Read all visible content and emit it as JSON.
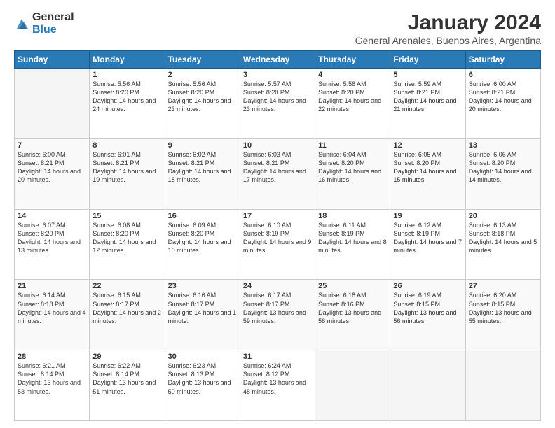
{
  "logo": {
    "general": "General",
    "blue": "Blue"
  },
  "title": "January 2024",
  "subtitle": "General Arenales, Buenos Aires, Argentina",
  "weekdays": [
    "Sunday",
    "Monday",
    "Tuesday",
    "Wednesday",
    "Thursday",
    "Friday",
    "Saturday"
  ],
  "weeks": [
    [
      {
        "day": "",
        "sunrise": "",
        "sunset": "",
        "daylight": ""
      },
      {
        "day": "1",
        "sunrise": "Sunrise: 5:56 AM",
        "sunset": "Sunset: 8:20 PM",
        "daylight": "Daylight: 14 hours and 24 minutes."
      },
      {
        "day": "2",
        "sunrise": "Sunrise: 5:56 AM",
        "sunset": "Sunset: 8:20 PM",
        "daylight": "Daylight: 14 hours and 23 minutes."
      },
      {
        "day": "3",
        "sunrise": "Sunrise: 5:57 AM",
        "sunset": "Sunset: 8:20 PM",
        "daylight": "Daylight: 14 hours and 23 minutes."
      },
      {
        "day": "4",
        "sunrise": "Sunrise: 5:58 AM",
        "sunset": "Sunset: 8:20 PM",
        "daylight": "Daylight: 14 hours and 22 minutes."
      },
      {
        "day": "5",
        "sunrise": "Sunrise: 5:59 AM",
        "sunset": "Sunset: 8:21 PM",
        "daylight": "Daylight: 14 hours and 21 minutes."
      },
      {
        "day": "6",
        "sunrise": "Sunrise: 6:00 AM",
        "sunset": "Sunset: 8:21 PM",
        "daylight": "Daylight: 14 hours and 20 minutes."
      }
    ],
    [
      {
        "day": "7",
        "sunrise": "Sunrise: 6:00 AM",
        "sunset": "Sunset: 8:21 PM",
        "daylight": "Daylight: 14 hours and 20 minutes."
      },
      {
        "day": "8",
        "sunrise": "Sunrise: 6:01 AM",
        "sunset": "Sunset: 8:21 PM",
        "daylight": "Daylight: 14 hours and 19 minutes."
      },
      {
        "day": "9",
        "sunrise": "Sunrise: 6:02 AM",
        "sunset": "Sunset: 8:21 PM",
        "daylight": "Daylight: 14 hours and 18 minutes."
      },
      {
        "day": "10",
        "sunrise": "Sunrise: 6:03 AM",
        "sunset": "Sunset: 8:21 PM",
        "daylight": "Daylight: 14 hours and 17 minutes."
      },
      {
        "day": "11",
        "sunrise": "Sunrise: 6:04 AM",
        "sunset": "Sunset: 8:20 PM",
        "daylight": "Daylight: 14 hours and 16 minutes."
      },
      {
        "day": "12",
        "sunrise": "Sunrise: 6:05 AM",
        "sunset": "Sunset: 8:20 PM",
        "daylight": "Daylight: 14 hours and 15 minutes."
      },
      {
        "day": "13",
        "sunrise": "Sunrise: 6:06 AM",
        "sunset": "Sunset: 8:20 PM",
        "daylight": "Daylight: 14 hours and 14 minutes."
      }
    ],
    [
      {
        "day": "14",
        "sunrise": "Sunrise: 6:07 AM",
        "sunset": "Sunset: 8:20 PM",
        "daylight": "Daylight: 14 hours and 13 minutes."
      },
      {
        "day": "15",
        "sunrise": "Sunrise: 6:08 AM",
        "sunset": "Sunset: 8:20 PM",
        "daylight": "Daylight: 14 hours and 12 minutes."
      },
      {
        "day": "16",
        "sunrise": "Sunrise: 6:09 AM",
        "sunset": "Sunset: 8:20 PM",
        "daylight": "Daylight: 14 hours and 10 minutes."
      },
      {
        "day": "17",
        "sunrise": "Sunrise: 6:10 AM",
        "sunset": "Sunset: 8:19 PM",
        "daylight": "Daylight: 14 hours and 9 minutes."
      },
      {
        "day": "18",
        "sunrise": "Sunrise: 6:11 AM",
        "sunset": "Sunset: 8:19 PM",
        "daylight": "Daylight: 14 hours and 8 minutes."
      },
      {
        "day": "19",
        "sunrise": "Sunrise: 6:12 AM",
        "sunset": "Sunset: 8:19 PM",
        "daylight": "Daylight: 14 hours and 7 minutes."
      },
      {
        "day": "20",
        "sunrise": "Sunrise: 6:13 AM",
        "sunset": "Sunset: 8:18 PM",
        "daylight": "Daylight: 14 hours and 5 minutes."
      }
    ],
    [
      {
        "day": "21",
        "sunrise": "Sunrise: 6:14 AM",
        "sunset": "Sunset: 8:18 PM",
        "daylight": "Daylight: 14 hours and 4 minutes."
      },
      {
        "day": "22",
        "sunrise": "Sunrise: 6:15 AM",
        "sunset": "Sunset: 8:17 PM",
        "daylight": "Daylight: 14 hours and 2 minutes."
      },
      {
        "day": "23",
        "sunrise": "Sunrise: 6:16 AM",
        "sunset": "Sunset: 8:17 PM",
        "daylight": "Daylight: 14 hours and 1 minute."
      },
      {
        "day": "24",
        "sunrise": "Sunrise: 6:17 AM",
        "sunset": "Sunset: 8:17 PM",
        "daylight": "Daylight: 13 hours and 59 minutes."
      },
      {
        "day": "25",
        "sunrise": "Sunrise: 6:18 AM",
        "sunset": "Sunset: 8:16 PM",
        "daylight": "Daylight: 13 hours and 58 minutes."
      },
      {
        "day": "26",
        "sunrise": "Sunrise: 6:19 AM",
        "sunset": "Sunset: 8:15 PM",
        "daylight": "Daylight: 13 hours and 56 minutes."
      },
      {
        "day": "27",
        "sunrise": "Sunrise: 6:20 AM",
        "sunset": "Sunset: 8:15 PM",
        "daylight": "Daylight: 13 hours and 55 minutes."
      }
    ],
    [
      {
        "day": "28",
        "sunrise": "Sunrise: 6:21 AM",
        "sunset": "Sunset: 8:14 PM",
        "daylight": "Daylight: 13 hours and 53 minutes."
      },
      {
        "day": "29",
        "sunrise": "Sunrise: 6:22 AM",
        "sunset": "Sunset: 8:14 PM",
        "daylight": "Daylight: 13 hours and 51 minutes."
      },
      {
        "day": "30",
        "sunrise": "Sunrise: 6:23 AM",
        "sunset": "Sunset: 8:13 PM",
        "daylight": "Daylight: 13 hours and 50 minutes."
      },
      {
        "day": "31",
        "sunrise": "Sunrise: 6:24 AM",
        "sunset": "Sunset: 8:12 PM",
        "daylight": "Daylight: 13 hours and 48 minutes."
      },
      {
        "day": "",
        "sunrise": "",
        "sunset": "",
        "daylight": ""
      },
      {
        "day": "",
        "sunrise": "",
        "sunset": "",
        "daylight": ""
      },
      {
        "day": "",
        "sunrise": "",
        "sunset": "",
        "daylight": ""
      }
    ]
  ]
}
